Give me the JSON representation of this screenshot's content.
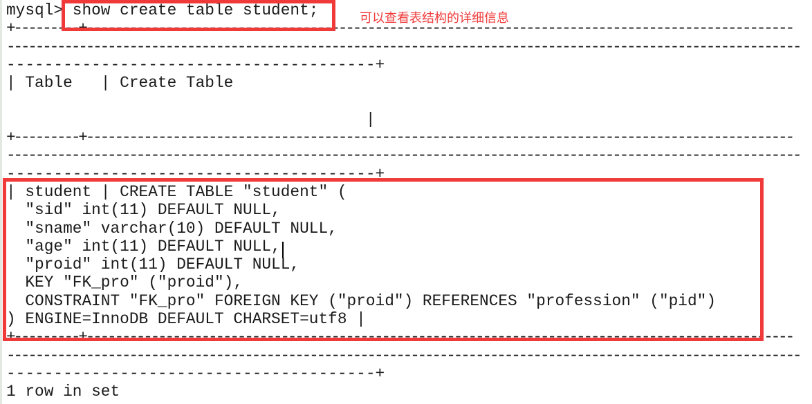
{
  "terminal": {
    "lines": [
      "mysql> show create table student;",
      "+---------+--------------------------------------------------------------------------------------------------",
      "--------------------------------------------------------------------------------------------------------------",
      "---------------------------------------+",
      "| Table   | Create Table",
      "",
      "                                      |",
      "+---------+--------------------------------------------------------------------------------------------------",
      "--------------------------------------------------------------------------------------------------------------",
      "---------------------------------------+",
      "| student | CREATE TABLE \"student\" (",
      "  \"sid\" int(11) DEFAULT NULL,",
      "  \"sname\" varchar(10) DEFAULT NULL,",
      "  \"age\" int(11) DEFAULT NULL,",
      "  \"proid\" int(11) DEFAULT NULL,",
      "  KEY \"FK_pro\" (\"proid\"),",
      "  CONSTRAINT \"FK_pro\" FOREIGN KEY (\"proid\") REFERENCES \"profession\" (\"pid\")",
      ") ENGINE=InnoDB DEFAULT CHARSET=utf8 |",
      "+---------+--------------------------------------------------------------------------------------------------",
      "--------------------------------------------------------------------------------------------------------------",
      "---------------------------------------+",
      "1 row in set"
    ]
  },
  "annotation": {
    "note": "可以查看表结构的详细信息",
    "color": "#f03a3a"
  }
}
